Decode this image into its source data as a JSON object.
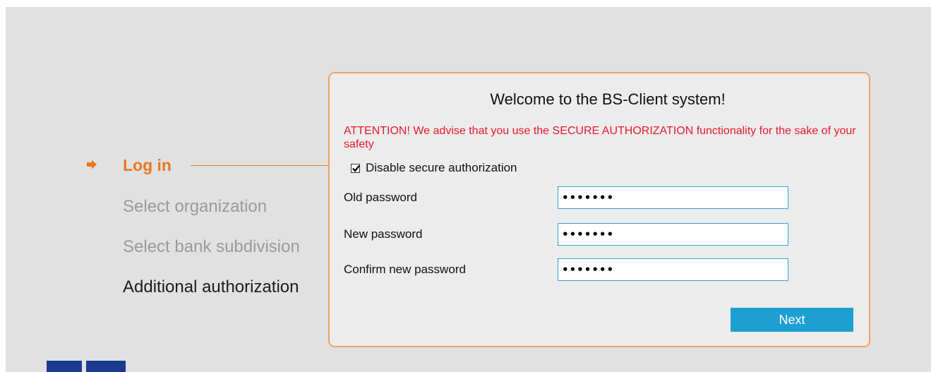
{
  "steps": {
    "login": "Log in",
    "select_org": "Select organization",
    "select_bank": "Select bank subdivision",
    "additional_auth": "Additional authorization"
  },
  "panel": {
    "title": "Welcome to the BS-Client system!",
    "attention": "ATTENTION! We advise that you use the SECURE AUTHORIZATION functionality for the sake of your safety",
    "checkbox_label": "Disable secure authorization",
    "checkbox_checked": true,
    "fields": {
      "old_password_label": "Old password",
      "old_password_value": "•••••••",
      "new_password_label": "New password",
      "new_password_value": "•••••••",
      "confirm_password_label": "Confirm new password",
      "confirm_password_value": "•••••••"
    },
    "next_label": "Next"
  },
  "colors": {
    "accent": "#e87722",
    "warning": "#e8192c",
    "button": "#1e9fd2",
    "background": "#e1e1e1",
    "logo": "#1c3a8f"
  },
  "icons": {
    "active_step": "arrow-right-icon",
    "checkbox": "checkmark-icon"
  }
}
